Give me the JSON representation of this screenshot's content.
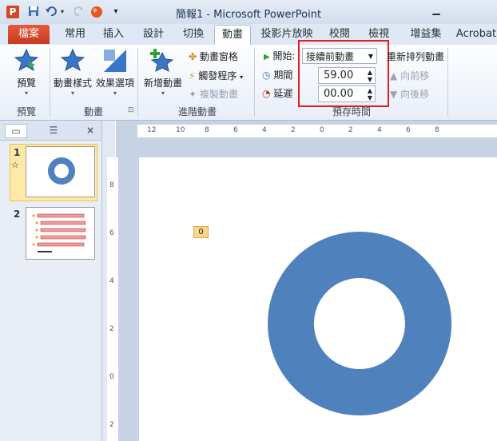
{
  "window": {
    "app_icon_letter": "P",
    "title": "簡報1 - Microsoft PowerPoint",
    "qat": [
      "save-icon",
      "undo-icon",
      "redo-icon",
      "record-icon",
      "customize-qat-icon"
    ]
  },
  "tabs": [
    {
      "label": "檔案"
    },
    {
      "label": "常用"
    },
    {
      "label": "插入"
    },
    {
      "label": "設計"
    },
    {
      "label": "切換"
    },
    {
      "label": "動畫"
    },
    {
      "label": "投影片放映"
    },
    {
      "label": "校閱"
    },
    {
      "label": "檢視"
    },
    {
      "label": "增益集"
    },
    {
      "label": "Acrobat"
    }
  ],
  "ribbon": {
    "preview": {
      "button_label": "預覽",
      "group_label": "預覽"
    },
    "animation": {
      "style_label": "動畫樣式",
      "effect_label": "效果選項",
      "group_label": "動畫"
    },
    "advanced": {
      "add_label": "新增動畫",
      "pane_label": "動畫窗格",
      "trigger_label": "觸發程序",
      "painter_label": "複製動畫",
      "group_label": "進階動畫"
    },
    "timing": {
      "start_label": "開始:",
      "start_value": "接續前動畫",
      "duration_label": "期間",
      "duration_value": "59.00",
      "delay_label": "延遲",
      "delay_value": "00.00",
      "reorder_label": "重新排列動畫",
      "move_earlier": "向前移",
      "move_later": "向後移",
      "group_label": "預存時間"
    },
    "colors": {
      "accent": "#4f81bd",
      "highlight": "#e02020"
    }
  },
  "panel": {
    "close": "×",
    "slides": [
      {
        "number": "1",
        "marker": "☆"
      },
      {
        "number": "2"
      }
    ]
  },
  "ruler": {
    "h_labels": [
      "12",
      "10",
      "8",
      "6",
      "4",
      "2",
      "0",
      "2",
      "4",
      "6",
      "8"
    ],
    "v_labels": [
      "8",
      "6",
      "4",
      "2",
      "0",
      "2"
    ]
  },
  "slide": {
    "animation_tag": "0",
    "donut_color": "#4f81bd"
  }
}
